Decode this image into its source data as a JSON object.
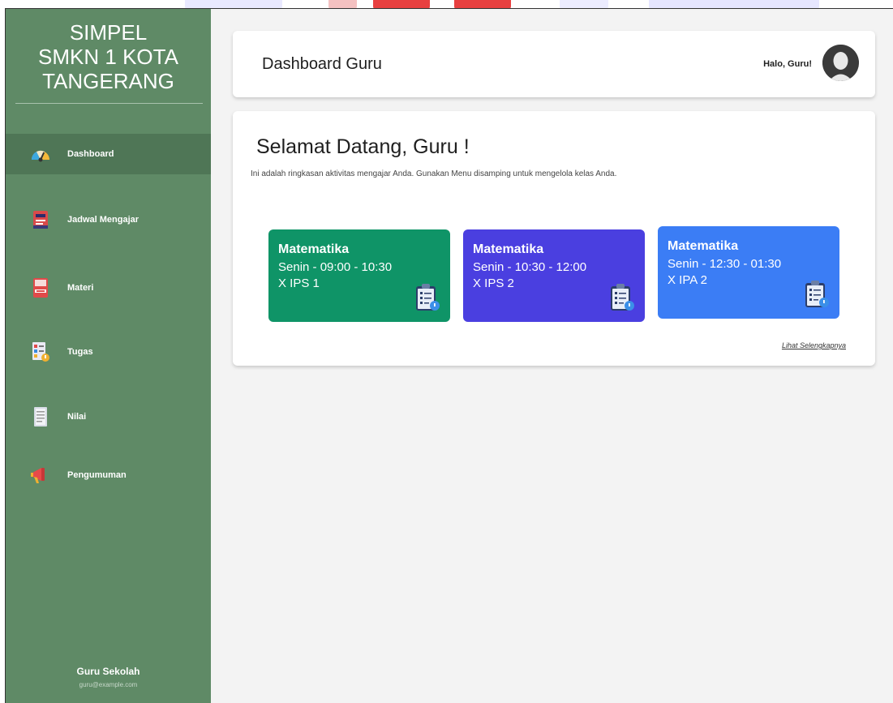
{
  "sidebar": {
    "brand_line1": "SIMPEL",
    "brand_line2": "SMKN 1 KOTA",
    "brand_line3": "TANGERANG",
    "items": [
      {
        "label": "Dashboard",
        "icon": "dashboard-gauge-icon",
        "active": true
      },
      {
        "label": "Jadwal Mengajar",
        "icon": "calendar-book-icon"
      },
      {
        "label": "Materi",
        "icon": "ebook-icon"
      },
      {
        "label": "Tugas",
        "icon": "assignment-icon"
      },
      {
        "label": "Nilai",
        "icon": "document-icon"
      },
      {
        "label": "Pengumuman",
        "icon": "megaphone-icon"
      }
    ],
    "user_name": "Guru Sekolah",
    "user_email": "guru@example.com"
  },
  "header": {
    "title": "Dashboard Guru",
    "greeting": "Halo, Guru!"
  },
  "welcome": {
    "title": "Selamat Datang, Guru !",
    "subtitle": "Ini adalah ringkasan aktivitas mengajar Anda. Gunakan Menu disamping untuk mengelola kelas Anda.",
    "see_more": "Lihat Selengkapnya"
  },
  "classes": [
    {
      "subject": "Matematika",
      "time": "Senin - 09:00 - 10:30",
      "room": "X IPS 1",
      "color": "#0f9467"
    },
    {
      "subject": "Matematika",
      "time": "Senin - 10:30 - 12:00",
      "room": "X IPS 2",
      "color": "#4a3fe0"
    },
    {
      "subject": "Matematika",
      "time": "Senin - 12:30 - 01:30",
      "room": "X IPA 2",
      "color": "#3b7df5"
    }
  ],
  "colors": {
    "sidebar_bg": "#5f8a66",
    "sidebar_active": "#4f7656",
    "page_bg": "#f3f3f3"
  }
}
